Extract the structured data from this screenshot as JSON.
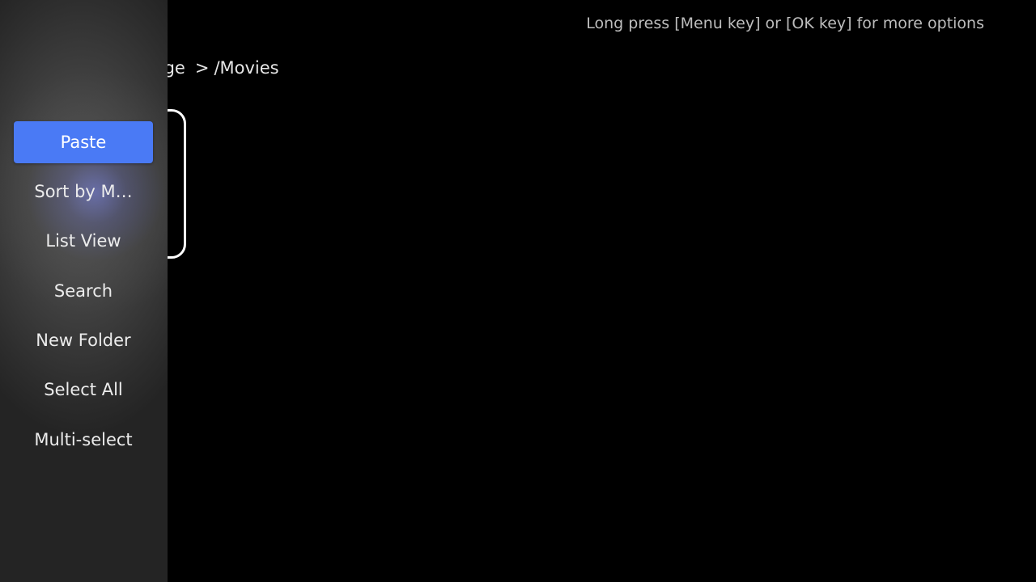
{
  "header": {
    "hint": "Long press [Menu key] or [OK key] for more options"
  },
  "breadcrumb": {
    "root": "torage",
    "separator": ">",
    "current": "/Movies"
  },
  "menu": {
    "items": [
      {
        "label": "Paste",
        "selected": true
      },
      {
        "label": "Sort by M…",
        "selected": false
      },
      {
        "label": "List View",
        "selected": false
      },
      {
        "label": "Search",
        "selected": false
      },
      {
        "label": "New Folder",
        "selected": false
      },
      {
        "label": "Select All",
        "selected": false
      },
      {
        "label": "Multi-select",
        "selected": false
      }
    ]
  },
  "colors": {
    "accent": "#4a7af5",
    "background": "#000000",
    "sidebar": "#242424"
  }
}
